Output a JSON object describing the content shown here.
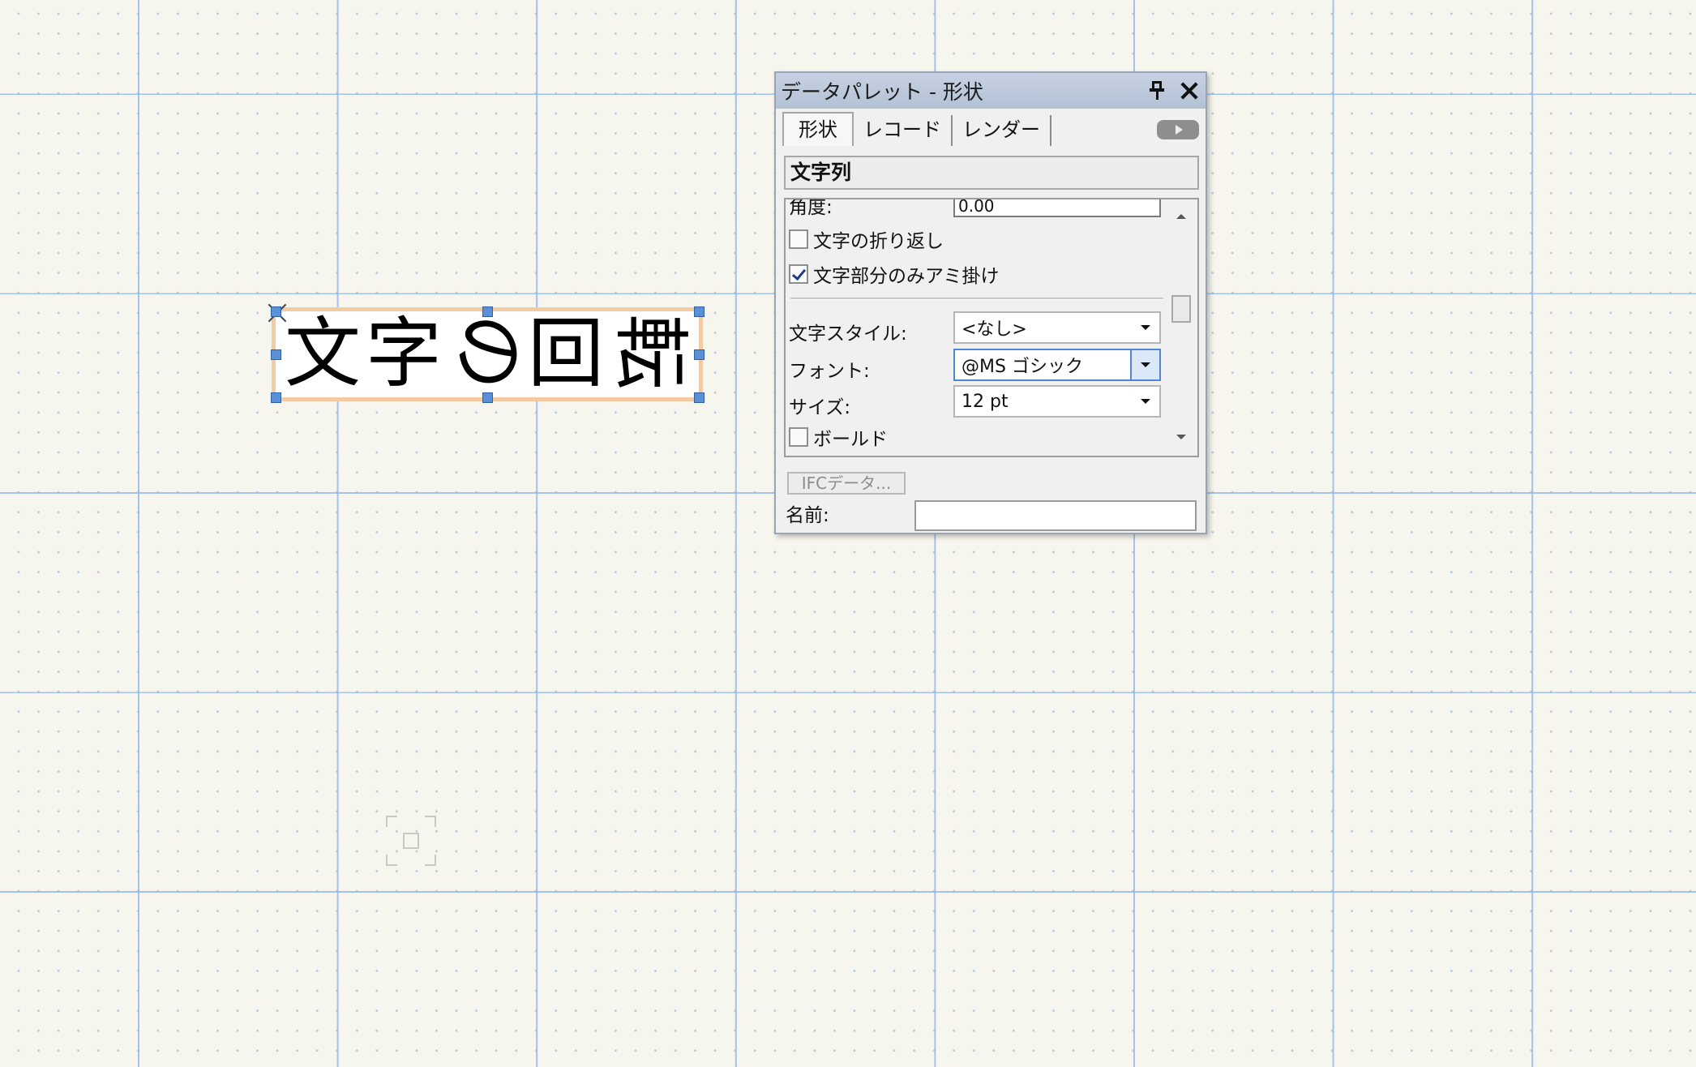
{
  "canvas": {
    "text_object": {
      "chars": [
        {
          "ch": "文",
          "rotated": false
        },
        {
          "ch": "字",
          "rotated": false
        },
        {
          "ch": "の",
          "rotated": true
        },
        {
          "ch": "回",
          "rotated": false
        },
        {
          "ch": "転",
          "rotated": true
        }
      ]
    }
  },
  "palette": {
    "title": "データパレット - 形状",
    "tabs": [
      "形状",
      "レコード",
      "レンダー"
    ],
    "section": "文字列",
    "angle_label": "角度:",
    "angle_value": "0.00",
    "wrap_label": "文字の折り返し",
    "wrap_checked": false,
    "hatch_label": "文字部分のみアミ掛け",
    "hatch_checked": true,
    "style_label": "文字スタイル:",
    "style_value": "<なし>",
    "font_label": "フォント:",
    "font_value": "@MS ゴシック",
    "size_label": "サイズ:",
    "size_value": "12 pt",
    "bold_label": "ボールド",
    "bold_checked": false,
    "ifc_button": "IFCデータ...",
    "name_label": "名前:",
    "name_value": ""
  },
  "colors": {
    "background": "#f6f6ee",
    "grid_line": "#96b9eb",
    "selection_highlight": "#f3cba3",
    "handle": "#5b8fd6",
    "titlebar": "#b3c1d5"
  },
  "icons": [
    "pin-icon",
    "close-icon",
    "expand-arrow-icon",
    "chevron-down-icon",
    "scroll-up-icon",
    "scroll-down-icon"
  ]
}
